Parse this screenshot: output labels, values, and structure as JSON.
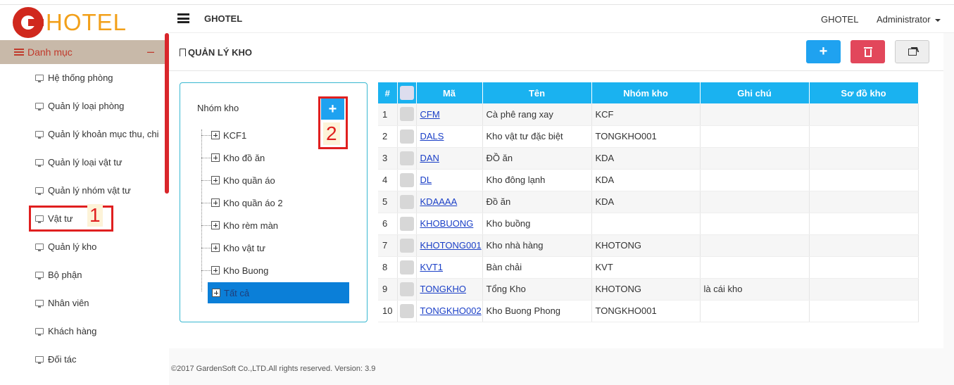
{
  "app": {
    "logo_text": "HOTEL",
    "brand": "GHOTEL"
  },
  "header": {
    "company": "GHOTEL",
    "user": "Administrator"
  },
  "sidebar": {
    "section": "Danh mục",
    "items": [
      {
        "label": "Hệ thống phòng"
      },
      {
        "label": "Quản lý loại phòng"
      },
      {
        "label": "Quản lý khoản mục thu, chi"
      },
      {
        "label": "Quản lý loại vật tư"
      },
      {
        "label": "Quản lý nhóm vật tư"
      },
      {
        "label": "Vật tư"
      },
      {
        "label": "Quản lý kho"
      },
      {
        "label": "Bộ phận"
      },
      {
        "label": "Nhân viên"
      },
      {
        "label": "Khách hàng"
      },
      {
        "label": "Đối tác"
      }
    ]
  },
  "annotations": {
    "one": "1",
    "two": "2"
  },
  "page": {
    "title": "QUẢN LÝ KHO",
    "add_label": "+",
    "tree_add_label": "+"
  },
  "tree": {
    "label": "Nhóm kho",
    "nodes": [
      "KCF1",
      "Kho đồ ăn",
      "Kho quần áo",
      "Kho quần áo 2",
      "Kho rèm màn",
      "Kho vật tư",
      "Kho Buong",
      "Tất cả"
    ],
    "selected": "Tất cả"
  },
  "table": {
    "headers": [
      "#",
      "",
      "Mã",
      "Tên",
      "Nhóm kho",
      "Ghi chú",
      "Sơ đồ kho"
    ],
    "rows": [
      {
        "n": "1",
        "code": "CFM",
        "name": "Cà phê rang xay",
        "group": "KCF",
        "note": "",
        "map": ""
      },
      {
        "n": "2",
        "code": "DALS",
        "name": "Kho vật tư đặc biệt",
        "group": "TONGKHO001",
        "note": "",
        "map": ""
      },
      {
        "n": "3",
        "code": "DAN",
        "name": "ĐỒ ăn",
        "group": "KDA",
        "note": "",
        "map": ""
      },
      {
        "n": "4",
        "code": "DL",
        "name": "Kho đông lạnh",
        "group": "KDA",
        "note": "",
        "map": ""
      },
      {
        "n": "5",
        "code": "KDAAAA",
        "name": "Đồ ăn",
        "group": "KDA",
        "note": "",
        "map": ""
      },
      {
        "n": "6",
        "code": "KHOBUONG",
        "name": "Kho buồng",
        "group": "",
        "note": "",
        "map": ""
      },
      {
        "n": "7",
        "code": "KHOTONG001",
        "name": "Kho nhà hàng",
        "group": "KHOTONG",
        "note": "",
        "map": ""
      },
      {
        "n": "8",
        "code": "KVT1",
        "name": "Bàn chải",
        "group": "KVT",
        "note": "",
        "map": ""
      },
      {
        "n": "9",
        "code": "TONGKHO",
        "name": "Tổng Kho",
        "group": "KHOTONG",
        "note": "là cái kho",
        "map": ""
      },
      {
        "n": "10",
        "code": "TONGKHO002",
        "name": "Kho Buong Phong",
        "group": "TONGKHO001",
        "note": "",
        "map": ""
      }
    ]
  },
  "footer": "©2017 GardenSoft Co.,LTD.All rights reserved. Version: 3.9",
  "colors": {
    "accent": "#1fa2f0",
    "danger": "#e2475b",
    "brand_red": "#d0281d",
    "logo_orange": "#f2a01a",
    "selected_node": "#0b7fd8"
  }
}
